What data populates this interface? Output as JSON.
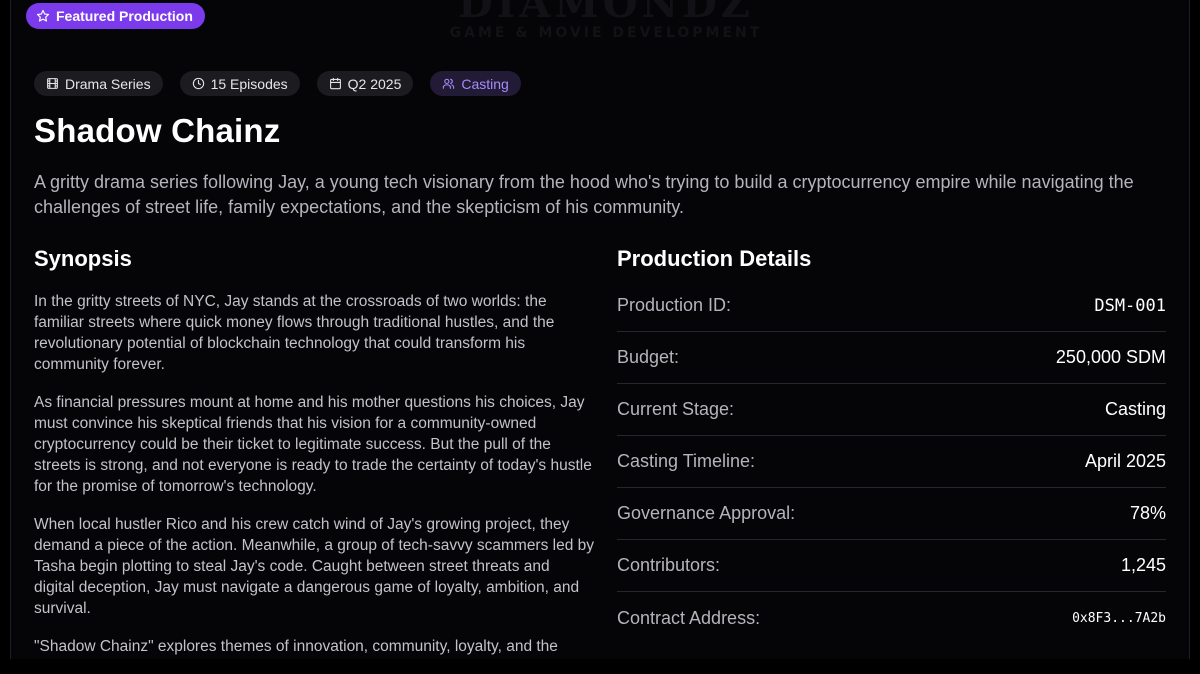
{
  "watermark": {
    "main": "DIAMONDZ",
    "sub": "GAME & MOVIE DEVELOPMENT"
  },
  "badge": {
    "label": "Featured Production",
    "icon": "star-icon"
  },
  "tags": [
    {
      "label": "Drama Series",
      "icon": "film-icon"
    },
    {
      "label": "15 Episodes",
      "icon": "clock-icon"
    },
    {
      "label": "Q2 2025",
      "icon": "calendar-icon"
    },
    {
      "label": "Casting",
      "icon": "users-icon"
    }
  ],
  "title": "Shadow Chainz",
  "description": "A gritty drama series following Jay, a young tech visionary from the hood who's trying to build a cryptocurrency empire while navigating the challenges of street life, family expectations, and the skepticism of his community.",
  "synopsis": {
    "heading": "Synopsis",
    "paragraphs": [
      "In the gritty streets of NYC, Jay stands at the crossroads of two worlds: the familiar streets where quick money flows through traditional hustles, and the revolutionary potential of blockchain technology that could transform his community forever.",
      "As financial pressures mount at home and his mother questions his choices, Jay must convince his skeptical friends that his vision for a community-owned cryptocurrency could be their ticket to legitimate success. But the pull of the streets is strong, and not everyone is ready to trade the certainty of today's hustle for the promise of tomorrow's technology.",
      "When local hustler Rico and his crew catch wind of Jay's growing project, they demand a piece of the action. Meanwhile, a group of tech-savvy scammers led by Tasha begin plotting to steal Jay's code. Caught between street threats and digital deception, Jay must navigate a dangerous game of loyalty, ambition, and survival.",
      "\"Shadow Chainz\" explores themes of innovation, community, loyalty, and the"
    ]
  },
  "details": {
    "heading": "Production Details",
    "rows": [
      {
        "label": "Production ID:",
        "value": "DSM-001"
      },
      {
        "label": "Budget:",
        "value": "250,000 SDM"
      },
      {
        "label": "Current Stage:",
        "value": "Casting"
      },
      {
        "label": "Casting Timeline:",
        "value": "April 2025"
      },
      {
        "label": "Governance Approval:",
        "value": "78%"
      },
      {
        "label": "Contributors:",
        "value": "1,245"
      },
      {
        "label": "Contract Address:",
        "value": "0x8F3...7A2b"
      }
    ]
  },
  "colors": {
    "accent": "#7c3aed",
    "accent_text": "#a78bfa",
    "background": "#050507"
  }
}
